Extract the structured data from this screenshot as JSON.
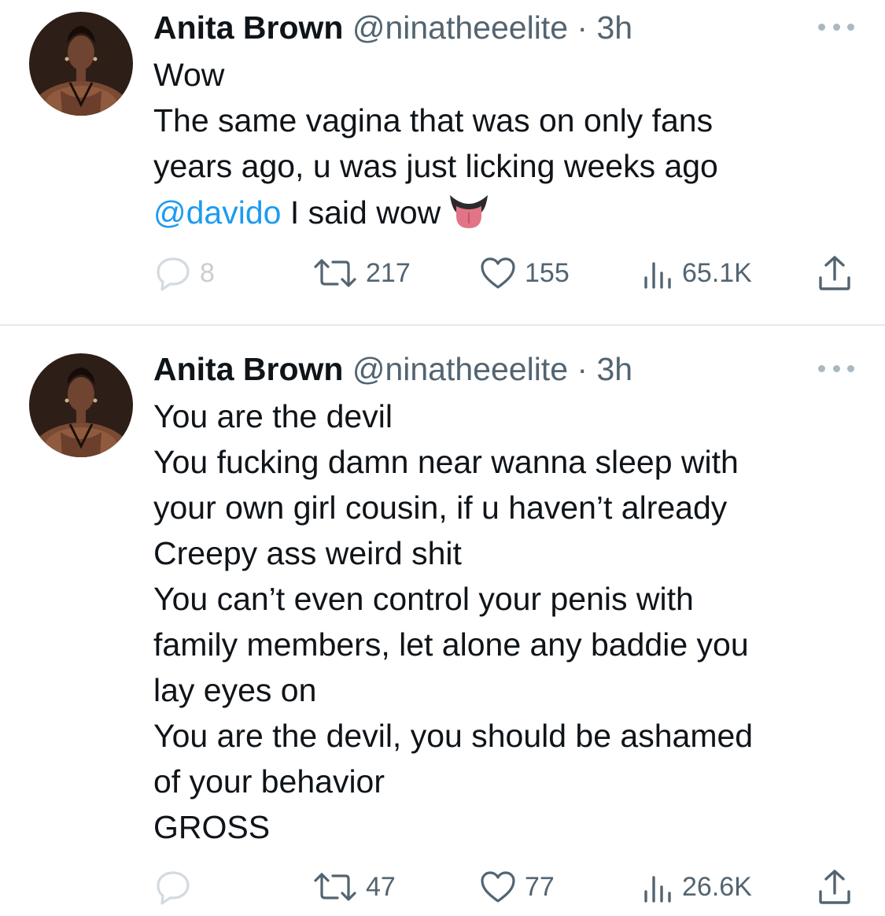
{
  "tweets": [
    {
      "author": {
        "name": "Anita Brown",
        "handle": "@ninatheeelite",
        "separator": "·",
        "time": "3h",
        "avatar": "profile-photo"
      },
      "lines": [
        "Wow",
        "The same vagina that was on only fans",
        "years ago, u was just licking weeks ago"
      ],
      "last_line": {
        "mention": "@davido",
        "text": " I said wow",
        "emoji": "tongue-emoji"
      },
      "stats": {
        "replies": "8",
        "retweets": "217",
        "likes": "155",
        "views": "65.1K"
      }
    },
    {
      "author": {
        "name": "Anita Brown",
        "handle": "@ninatheeelite",
        "separator": "·",
        "time": "3h",
        "avatar": "profile-photo"
      },
      "lines": [
        "You are the devil",
        "You fucking damn near wanna sleep with",
        "your own girl cousin, if u haven’t already",
        "Creepy ass weird shit",
        "You can’t even control your penis with",
        "family members, let alone any baddie you",
        "lay eyes on",
        "You are the devil, you should be ashamed",
        "of your behavior",
        "GROSS"
      ],
      "stats": {
        "replies": "",
        "retweets": "47",
        "likes": "77",
        "views": "26.6K"
      }
    }
  ],
  "icons": {
    "reply": "reply-icon",
    "retweet": "retweet-icon",
    "like": "heart-icon",
    "views": "views-icon",
    "share": "share-icon",
    "more": "more-icon"
  },
  "colors": {
    "text": "#0f1419",
    "secondary": "#536471",
    "mention": "#1d9bf0",
    "divider": "#e6e9ec"
  }
}
